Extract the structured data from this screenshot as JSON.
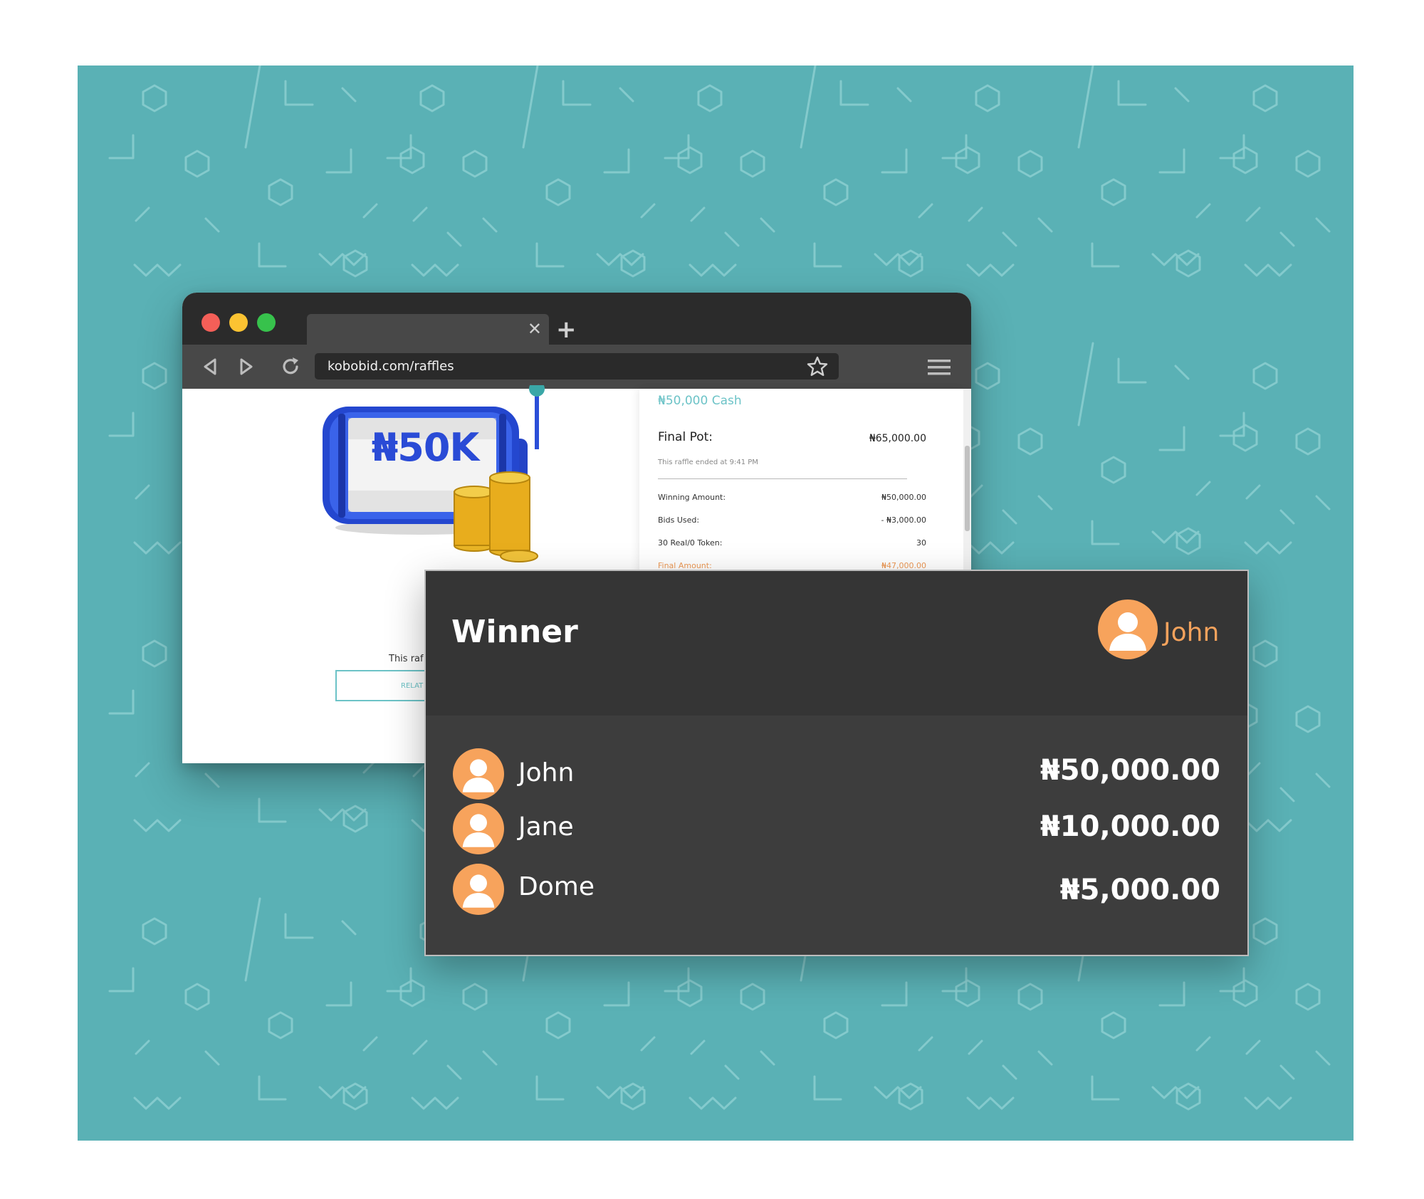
{
  "colors": {
    "background": "#5ab1b5",
    "accent_teal": "#6cc3c7",
    "winner_orange": "#f4a25c",
    "panel_dark": "#3a3a3a",
    "slot_blue": "#2a4bd6"
  },
  "browser": {
    "url": "kobobid.com/raffles",
    "tab_title": "",
    "icons": [
      "back-icon",
      "forward-icon",
      "reload-icon",
      "star-icon",
      "menu-icon",
      "close-tab-icon",
      "new-tab-icon"
    ]
  },
  "raffle": {
    "slot_label": "₦50K",
    "prize": "₦50,000 Cash",
    "final_pot_label": "Final Pot:",
    "final_pot_value": "₦65,000.00",
    "ended_note": "This raffle ended at 9:41 PM",
    "rows": [
      {
        "label": "Winning Amount:",
        "value": "₦50,000.00"
      },
      {
        "label": "Bids Used:",
        "value": "- ₦3,000.00"
      },
      {
        "label": "30 Real/0 Token:",
        "value": "30"
      },
      {
        "label": "Final Amount:",
        "value": "₦47,000.00"
      }
    ],
    "page_note": "This raf",
    "related_button": "RELAT"
  },
  "winner_panel": {
    "title": "Winner",
    "winner_name": "John",
    "players": [
      {
        "name": "John",
        "amount": "₦50,000.00"
      },
      {
        "name": "Jane",
        "amount": "₦10,000.00"
      },
      {
        "name": "Dome",
        "amount": "₦5,000.00"
      }
    ]
  }
}
